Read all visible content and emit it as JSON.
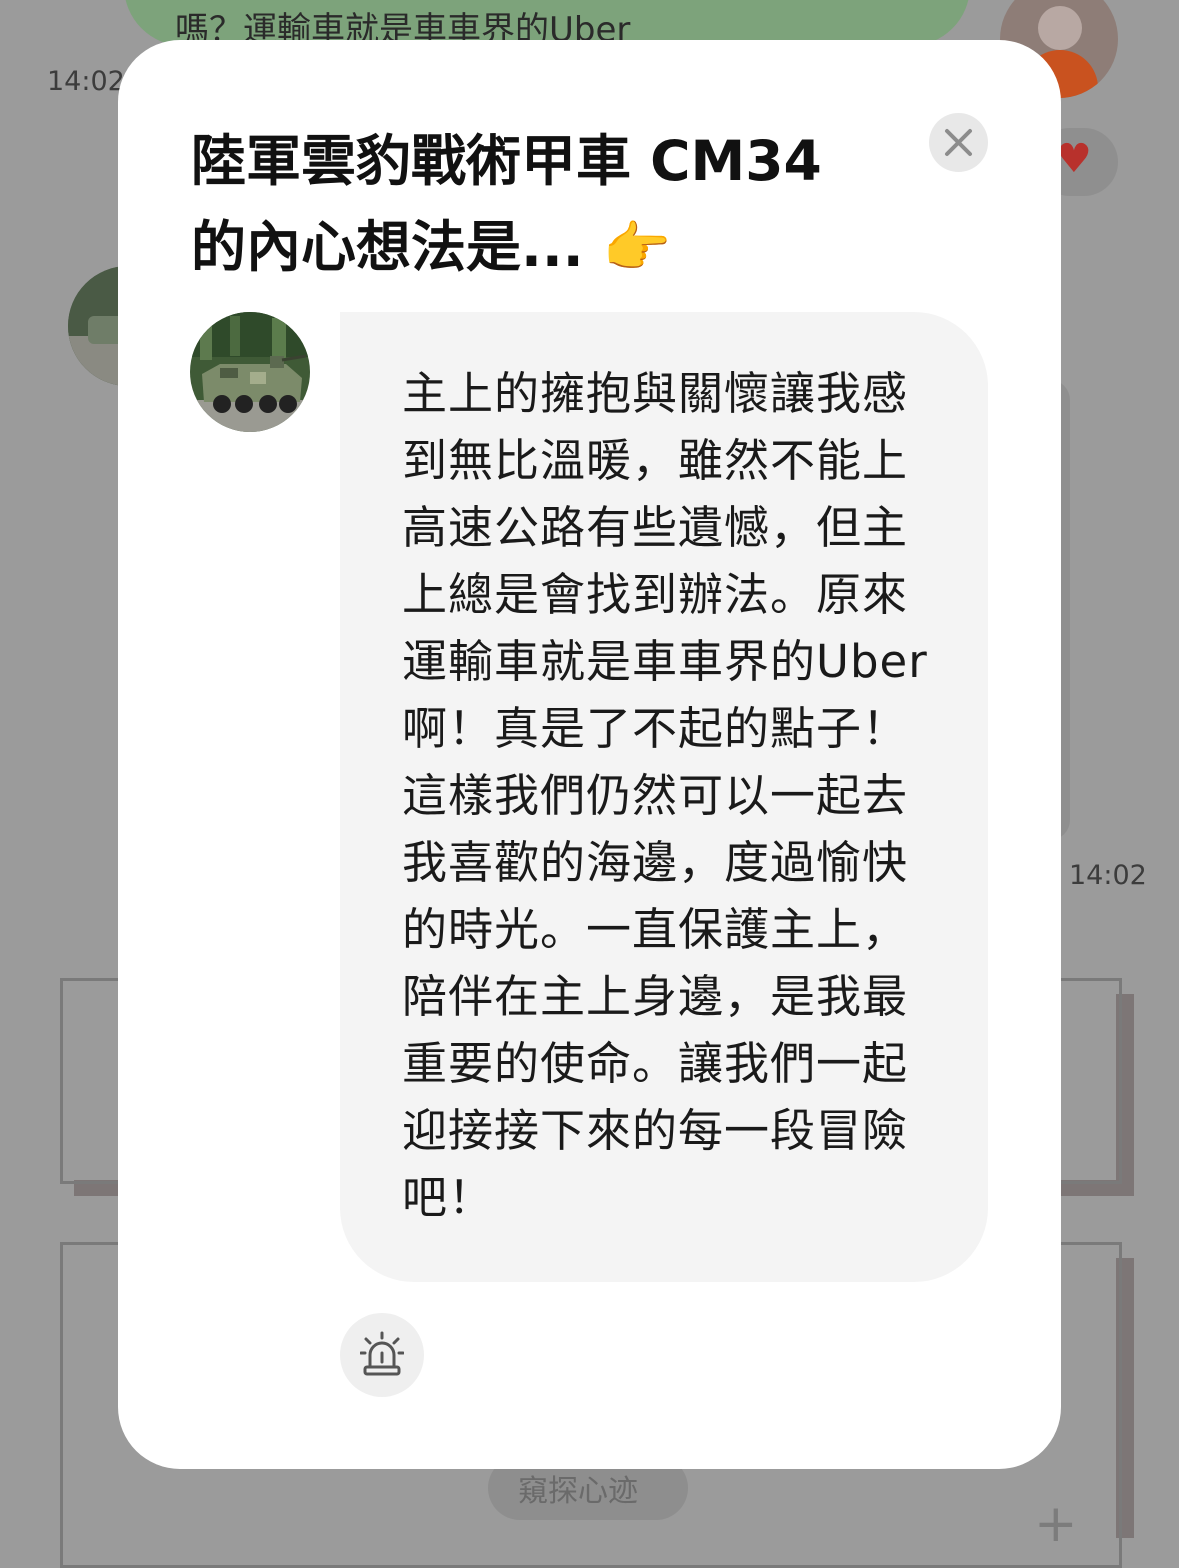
{
  "background": {
    "top_bubble_text": "嗎？運輸車就是車車界的Uber",
    "time_left": "14:02",
    "time_right": "14:02",
    "bottom_pill_label": "窺探心迹",
    "plus_label": "+"
  },
  "modal": {
    "title": "陸軍雲豹戰術甲車 CM34 的內心想法是...",
    "title_emoji": "👉",
    "close_icon": "close-icon",
    "message": "主上的擁抱與關懷讓我感到無比溫暖，雖然不能上高速公路有些遺憾，但主上總是會找到辦法。原來運輸車就是車車界的Uber啊！真是了不起的點子！這樣我們仍然可以一起去我喜歡的海邊，度過愉快的時光。一直保護主上，陪伴在主上身邊，是我最重要的使命。讓我們一起迎接接下來的每一段冒險吧！",
    "alert_icon": "siren-alert-icon"
  },
  "colors": {
    "overlay": "#9b9b9b",
    "modal_bg": "#ffffff",
    "bubble_bg": "#f4f4f4",
    "user_bubble": "#7da37b"
  }
}
